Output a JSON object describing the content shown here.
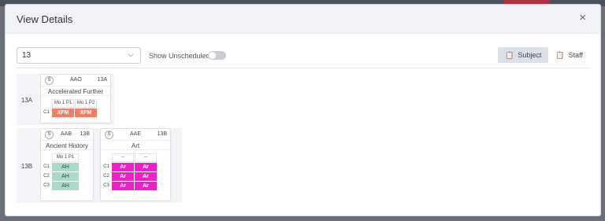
{
  "modal": {
    "title": "View Details",
    "close_glyph": "×"
  },
  "toolbar": {
    "select_value": "13",
    "select_chevron": "⌵",
    "toggle_label": "Show Unscheduled",
    "toggle_on": false,
    "view_buttons": [
      {
        "label": "Subject",
        "icon": "clipboard-icon",
        "active": true
      },
      {
        "label": "Staff",
        "icon": "clipboard-icon",
        "active": false
      }
    ]
  },
  "groups": [
    {
      "label": "13A",
      "cards": [
        {
          "badge": "S",
          "code": "AAO",
          "group": "13A",
          "name": "Accelerated Further",
          "periods": [
            "Mo 1 P1",
            "Mo 1 P2"
          ],
          "rows": [
            {
              "label": "C1",
              "cells": [
                "XFM",
                "XFM"
              ]
            }
          ]
        }
      ]
    },
    {
      "label": "13B",
      "cards": [
        {
          "badge": "S",
          "code": "AAB",
          "group": "13B",
          "name": "Ancient History",
          "periods": [
            "Mo 1 P1"
          ],
          "rows": [
            {
              "label": "C1",
              "cells": [
                "AH"
              ]
            },
            {
              "label": "C2",
              "cells": [
                "AH"
              ]
            },
            {
              "label": "C3",
              "cells": [
                "AH"
              ]
            }
          ]
        },
        {
          "badge": "S",
          "code": "AAE",
          "group": "13B",
          "name": "Art",
          "periods": [
            "--",
            "--"
          ],
          "rows": [
            {
              "label": "C1",
              "cells": [
                "Ar",
                "Ar"
              ]
            },
            {
              "label": "C2",
              "cells": [
                "Ar",
                "Ar"
              ]
            },
            {
              "label": "C3",
              "cells": [
                "Ar",
                "Ar"
              ]
            }
          ]
        }
      ]
    }
  ],
  "colors": {
    "xfm": "#f27e66",
    "ah": "#a9dcc8",
    "ar": "#f01ecb",
    "active_tab": "#dbe1ea"
  }
}
